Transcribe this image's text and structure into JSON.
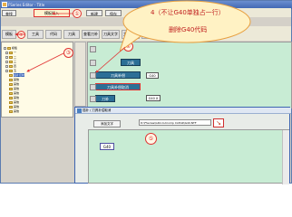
{
  "window": {
    "title": "FSeries Editor - Title"
  },
  "toolbar": {
    "row1": [
      "",
      "",
      "",
      "",
      "",
      "",
      "",
      ""
    ],
    "search_btn": "查找",
    "new_btn": "新建",
    "save_btn": "保存",
    "tabs": [
      "模板",
      "工具",
      "代码",
      "刀具",
      "查看刀补",
      "刀具文字",
      "文字编辑",
      "文字修改",
      "添加(G)"
    ]
  },
  "steps": {
    "s1": "①",
    "s2": "②",
    "s3": "③",
    "s4": "④",
    "s5": "⑤"
  },
  "highlight_tab": "模板插入",
  "tree": {
    "items": [
      "模板",
      "一",
      "二",
      "三",
      "四",
      "五",
      "插补控制",
      "其他",
      "其他",
      "其他",
      "其他",
      "其他",
      "其他",
      "其他",
      "其他",
      "其他",
      "其他"
    ]
  },
  "editor": {
    "blocks": [
      "刀具",
      "刀具补偿",
      "刀具补偿取消",
      "刀补"
    ],
    "side_labels": [
      "G40",
      "0.0",
      "",
      "G40 X"
    ]
  },
  "callout": {
    "line1": "4（不让G40单独占一行）",
    "line2": "删除G40代码"
  },
  "dialog": {
    "title": "插补 / 刀具补偿取消",
    "add_btn": "添加文字",
    "path": "D:\\FSeries\\G40-Cutcomp CLEAR\\G40.NTF",
    "g_chip": "G40"
  },
  "colors": {
    "accent_red": "#e03030",
    "editor_bg": "#c8ecd4",
    "block_blue": "#2c6f96"
  }
}
